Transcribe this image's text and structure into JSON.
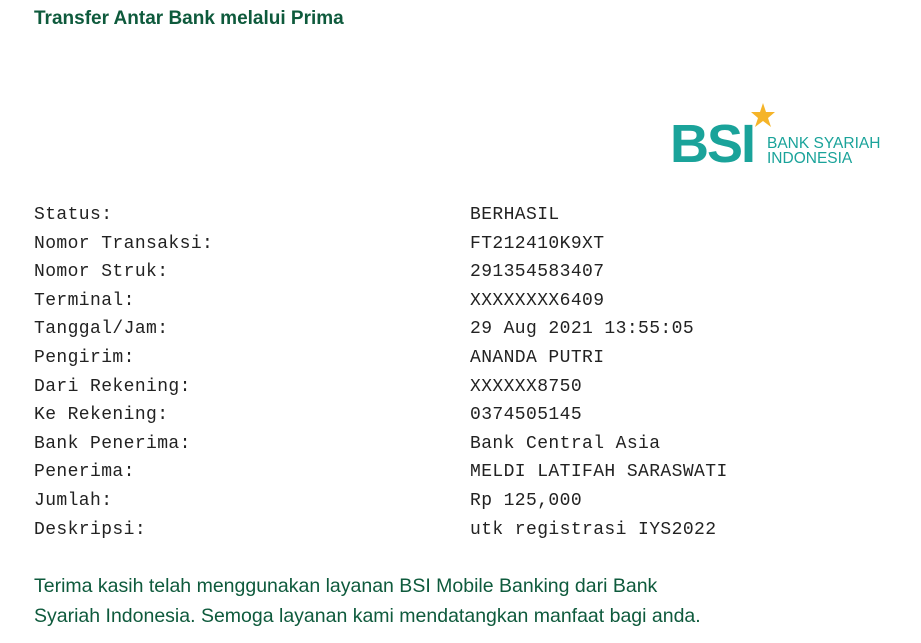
{
  "header": {
    "title": "Transfer Antar Bank melalui Prima"
  },
  "logo": {
    "mark": "BSI",
    "line1": "BANK SYARIAH",
    "line2": "INDONESIA",
    "brand_color": "#1aa39a",
    "star_color": "#f5b428"
  },
  "details": [
    {
      "label": "Status:",
      "value": "BERHASIL"
    },
    {
      "label": "Nomor Transaksi:",
      "value": "FT212410K9XT"
    },
    {
      "label": "Nomor Struk:",
      "value": "291354583407"
    },
    {
      "label": "Terminal:",
      "value": "XXXXXXXX6409"
    },
    {
      "label": "Tanggal/Jam:",
      "value": "29 Aug 2021 13:55:05"
    },
    {
      "label": "Pengirim:",
      "value": "ANANDA PUTRI"
    },
    {
      "label": "Dari Rekening:",
      "value": "XXXXXX8750"
    },
    {
      "label": "Ke Rekening:",
      "value": "0374505145"
    },
    {
      "label": "Bank Penerima:",
      "value": "Bank Central Asia"
    },
    {
      "label": "Penerima:",
      "value": "MELDI LATIFAH SARASWATI"
    },
    {
      "label": "Jumlah:",
      "value": "Rp 125,000"
    },
    {
      "label": "Deskripsi:",
      "value": "utk registrasi IYS2022"
    }
  ],
  "footer": {
    "line1": "Terima kasih telah menggunakan layanan BSI Mobile Banking dari Bank",
    "line2": "Syariah Indonesia. Semoga layanan kami mendatangkan manfaat bagi anda."
  },
  "colors": {
    "heading": "#0e5a3c",
    "text": "#222222"
  }
}
